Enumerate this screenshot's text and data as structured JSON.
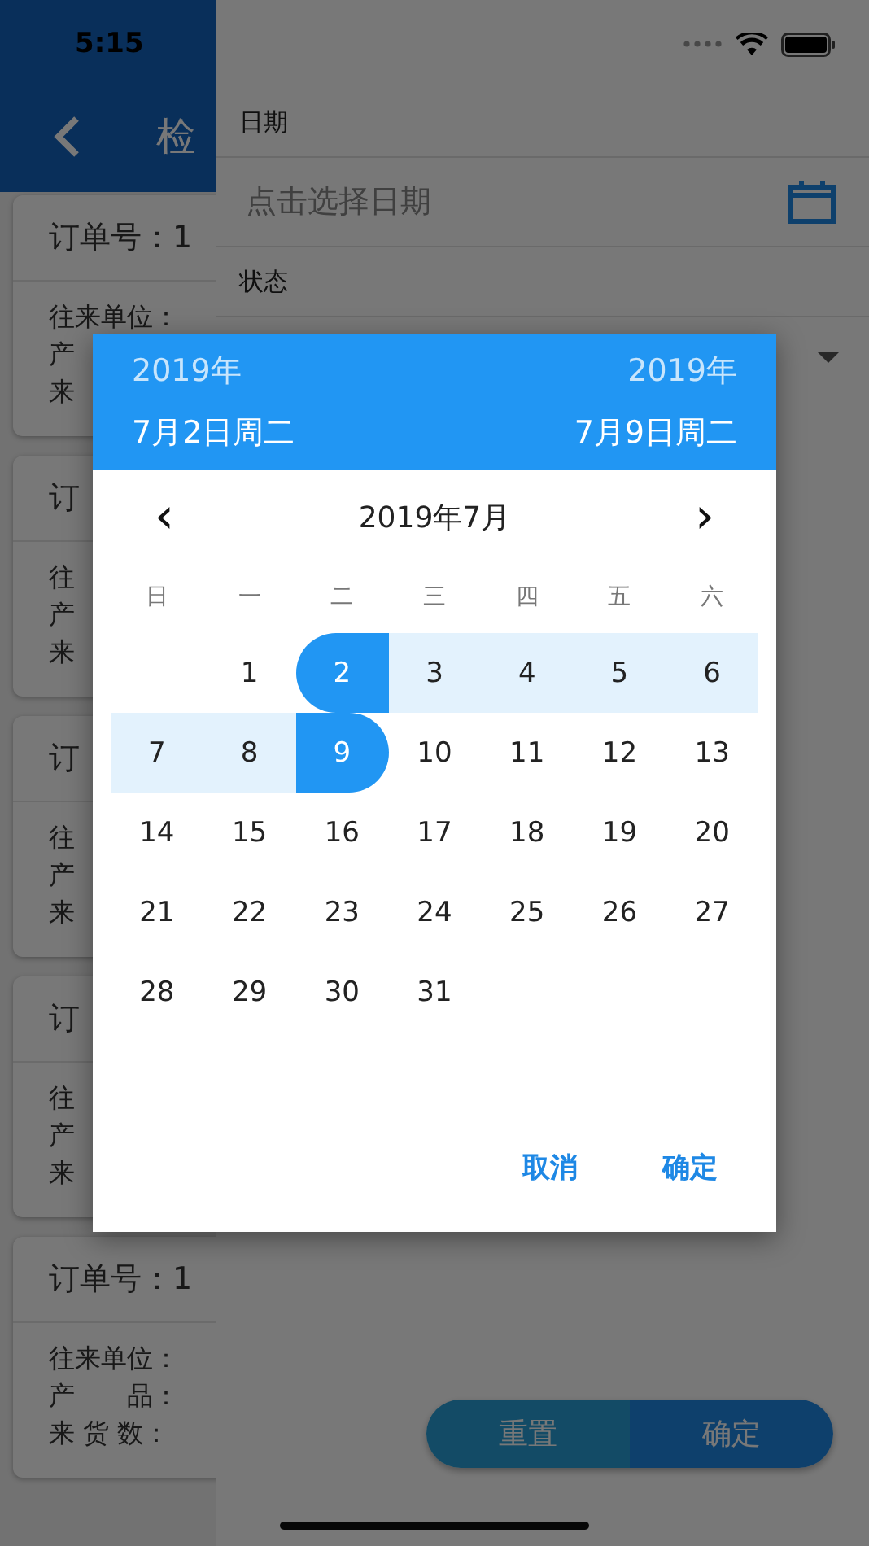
{
  "status_bar": {
    "time": "5:15"
  },
  "header": {
    "title": "检"
  },
  "cards": [
    {
      "title": "订单号：1",
      "lines": [
        "往来单位：",
        "产",
        "来"
      ]
    },
    {
      "title": "订",
      "lines": [
        "往",
        "产",
        "来"
      ]
    },
    {
      "title": "订",
      "lines": [
        "往",
        "产",
        "来"
      ]
    },
    {
      "title": "订",
      "lines": [
        "往",
        "产",
        "来"
      ]
    },
    {
      "title": "订单号：1",
      "lines": [
        "往来单位：",
        "产　　品：",
        "来 货 数："
      ]
    }
  ],
  "filter_drawer": {
    "date_label": "日期",
    "date_placeholder": "点击选择日期",
    "status_label": "状态",
    "buttons": [
      {
        "label": "重置",
        "kind": "secondary"
      },
      {
        "label": "确定",
        "kind": "primary"
      }
    ]
  },
  "date_picker": {
    "start_year": "2019年",
    "end_year": "2019年",
    "start_date": "7月2日周二",
    "end_date": "7月9日周二",
    "prev": "‹",
    "month": "2019年7月",
    "next": "›",
    "weekdays": [
      "日",
      "一",
      "二",
      "三",
      "四",
      "五",
      "六"
    ],
    "weeks": [
      {
        "days": [
          {
            "kind": "blank"
          },
          {
            "label": "1",
            "kind": "plain"
          },
          {
            "label": "2",
            "kind": "range_start"
          },
          {
            "label": "3",
            "kind": "range_middle"
          },
          {
            "label": "4",
            "kind": "range_middle"
          },
          {
            "label": "5",
            "kind": "range_middle"
          },
          {
            "label": "6",
            "kind": "range_middle"
          }
        ]
      },
      {
        "days": [
          {
            "label": "7",
            "kind": "range_middle"
          },
          {
            "label": "8",
            "kind": "range_middle"
          },
          {
            "label": "9",
            "kind": "range_end"
          },
          {
            "label": "10",
            "kind": "plain"
          },
          {
            "label": "11",
            "kind": "plain"
          },
          {
            "label": "12",
            "kind": "plain"
          },
          {
            "label": "13",
            "kind": "plain"
          }
        ]
      },
      {
        "days": [
          {
            "label": "14",
            "kind": "plain"
          },
          {
            "label": "15",
            "kind": "plain"
          },
          {
            "label": "16",
            "kind": "plain"
          },
          {
            "label": "17",
            "kind": "plain"
          },
          {
            "label": "18",
            "kind": "plain"
          },
          {
            "label": "19",
            "kind": "plain"
          },
          {
            "label": "20",
            "kind": "plain"
          }
        ]
      },
      {
        "days": [
          {
            "label": "21",
            "kind": "plain"
          },
          {
            "label": "22",
            "kind": "plain"
          },
          {
            "label": "23",
            "kind": "plain"
          },
          {
            "label": "24",
            "kind": "plain"
          },
          {
            "label": "25",
            "kind": "plain"
          },
          {
            "label": "26",
            "kind": "plain"
          },
          {
            "label": "27",
            "kind": "plain"
          }
        ]
      },
      {
        "days": [
          {
            "label": "28",
            "kind": "plain"
          },
          {
            "label": "29",
            "kind": "plain"
          },
          {
            "label": "30",
            "kind": "plain"
          },
          {
            "label": "31",
            "kind": "plain"
          }
        ]
      }
    ],
    "actions": [
      "取消",
      "确定"
    ]
  }
}
